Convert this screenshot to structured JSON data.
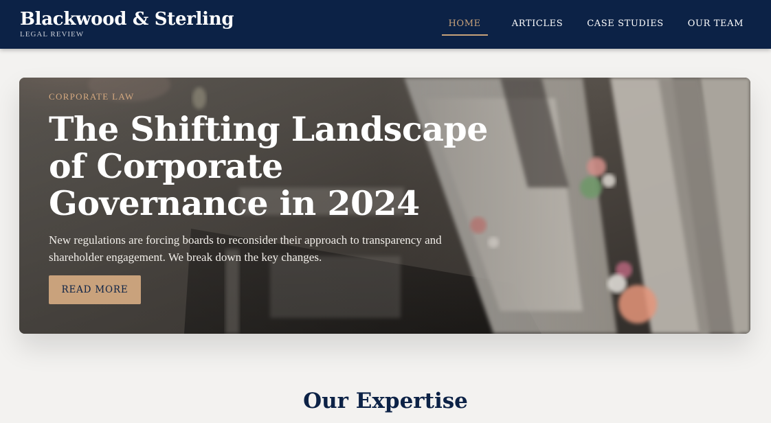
{
  "brand": {
    "name": "Blackwood & Sterling",
    "tagline": "LEGAL REVIEW"
  },
  "nav": {
    "items": [
      {
        "label": "HOME",
        "active": true
      },
      {
        "label": "ARTICLES",
        "active": false
      },
      {
        "label": "CASE STUDIES",
        "active": false
      },
      {
        "label": "OUR TEAM",
        "active": false
      }
    ]
  },
  "hero": {
    "category": "CORPORATE LAW",
    "title": "The Shifting Landscape of Corporate Governance in 2024",
    "description": "New regulations are forcing boards to reconsider their approach to transparency and shareholder engagement. We break down the key changes.",
    "cta_label": "READ MORE",
    "image_icon": "books-and-flowers-photo"
  },
  "expertise": {
    "heading": "Our Expertise"
  },
  "colors": {
    "navy": "#0c2246",
    "gold": "#c8a27a",
    "background": "#f3f2f0"
  }
}
